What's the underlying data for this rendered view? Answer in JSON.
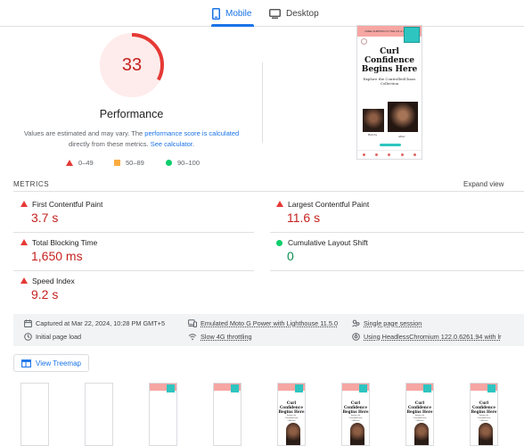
{
  "tabs": [
    {
      "label": "Mobile",
      "icon": "phone-icon",
      "active": true
    },
    {
      "label": "Desktop",
      "icon": "monitor-icon",
      "active": false
    }
  ],
  "score": {
    "value": "33",
    "fraction": 0.33,
    "title": "Performance",
    "desc_prefix": "Values are estimated and may vary. The ",
    "desc_link1": "performance score is calculated",
    "desc_mid": "directly from these metrics. ",
    "desc_link2": "See calculator",
    "desc_suffix": "."
  },
  "legend": [
    {
      "icon": "fail-triangle-icon",
      "label": "0–49"
    },
    {
      "icon": "average-square-icon",
      "label": "50–89"
    },
    {
      "icon": "pass-circle-icon",
      "label": "90–100"
    }
  ],
  "preview": {
    "top_banner": "FREE SHIPPING IN THE US & CANADA",
    "headline": "Curl Confidence Begins Here",
    "subtitle": "Explore the ControlledChaos Collection",
    "caption_left": "Before",
    "caption_right": "After"
  },
  "filmstrip": {
    "headline": "Curl Confidence Begins Here",
    "subtitle": "Explore the ControlledChaos Collection"
  },
  "metrics": {
    "label": "METRICS",
    "expand": "Expand view",
    "items": [
      {
        "name": "First Contentful Paint",
        "value": "3.7 s",
        "status": "fail"
      },
      {
        "name": "Largest Contentful Paint",
        "value": "11.6 s",
        "status": "fail"
      },
      {
        "name": "Total Blocking Time",
        "value": "1,650 ms",
        "status": "fail"
      },
      {
        "name": "Cumulative Layout Shift",
        "value": "0",
        "status": "pass"
      },
      {
        "name": "Speed Index",
        "value": "9.2 s",
        "status": "fail"
      }
    ]
  },
  "info": {
    "captured": "Captured at Mar 22, 2024, 10:28 PM GMT+5",
    "emulated": "Emulated Moto G Power with Lighthouse 11.5.0",
    "session": "Single page session",
    "initial_load": "Initial page load",
    "throttling": "Slow 4G throttling",
    "browser": "Using HeadlessChromium 122.0.6261.94 with lr"
  },
  "treemap_label": "View Treemap",
  "colors": {
    "accent": "#1a73e8",
    "fail": "#c5221f",
    "fail_icon": "#e53935",
    "average": "#fbac40",
    "pass": "#0cce6b"
  }
}
